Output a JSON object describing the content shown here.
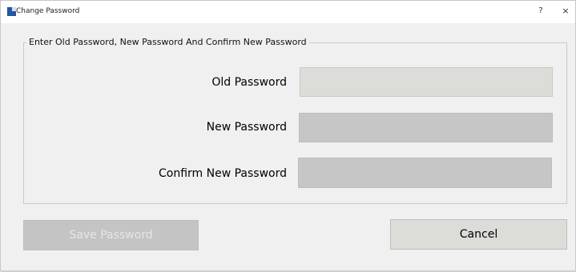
{
  "window": {
    "title": "Change Password",
    "help_glyph": "?",
    "close_glyph": "×",
    "icon": "app-icon"
  },
  "group": {
    "legend": "Enter Old Password, New Password And Confirm New Password"
  },
  "fields": {
    "old_password": {
      "label": "Old Password",
      "value": "",
      "placeholder": ""
    },
    "new_password": {
      "label": "New Password",
      "value": "",
      "placeholder": ""
    },
    "confirm_password": {
      "label": "Confirm New Password",
      "value": "",
      "placeholder": ""
    }
  },
  "buttons": {
    "save_label": "Save Password",
    "save_enabled": false,
    "cancel_label": "Cancel"
  },
  "colors": {
    "window_bg": "#f0f0f0",
    "active_input_bg": "#dcdcd8",
    "inactive_input_bg": "#c6c6c6",
    "disabled_text": "#e6e6e6"
  }
}
